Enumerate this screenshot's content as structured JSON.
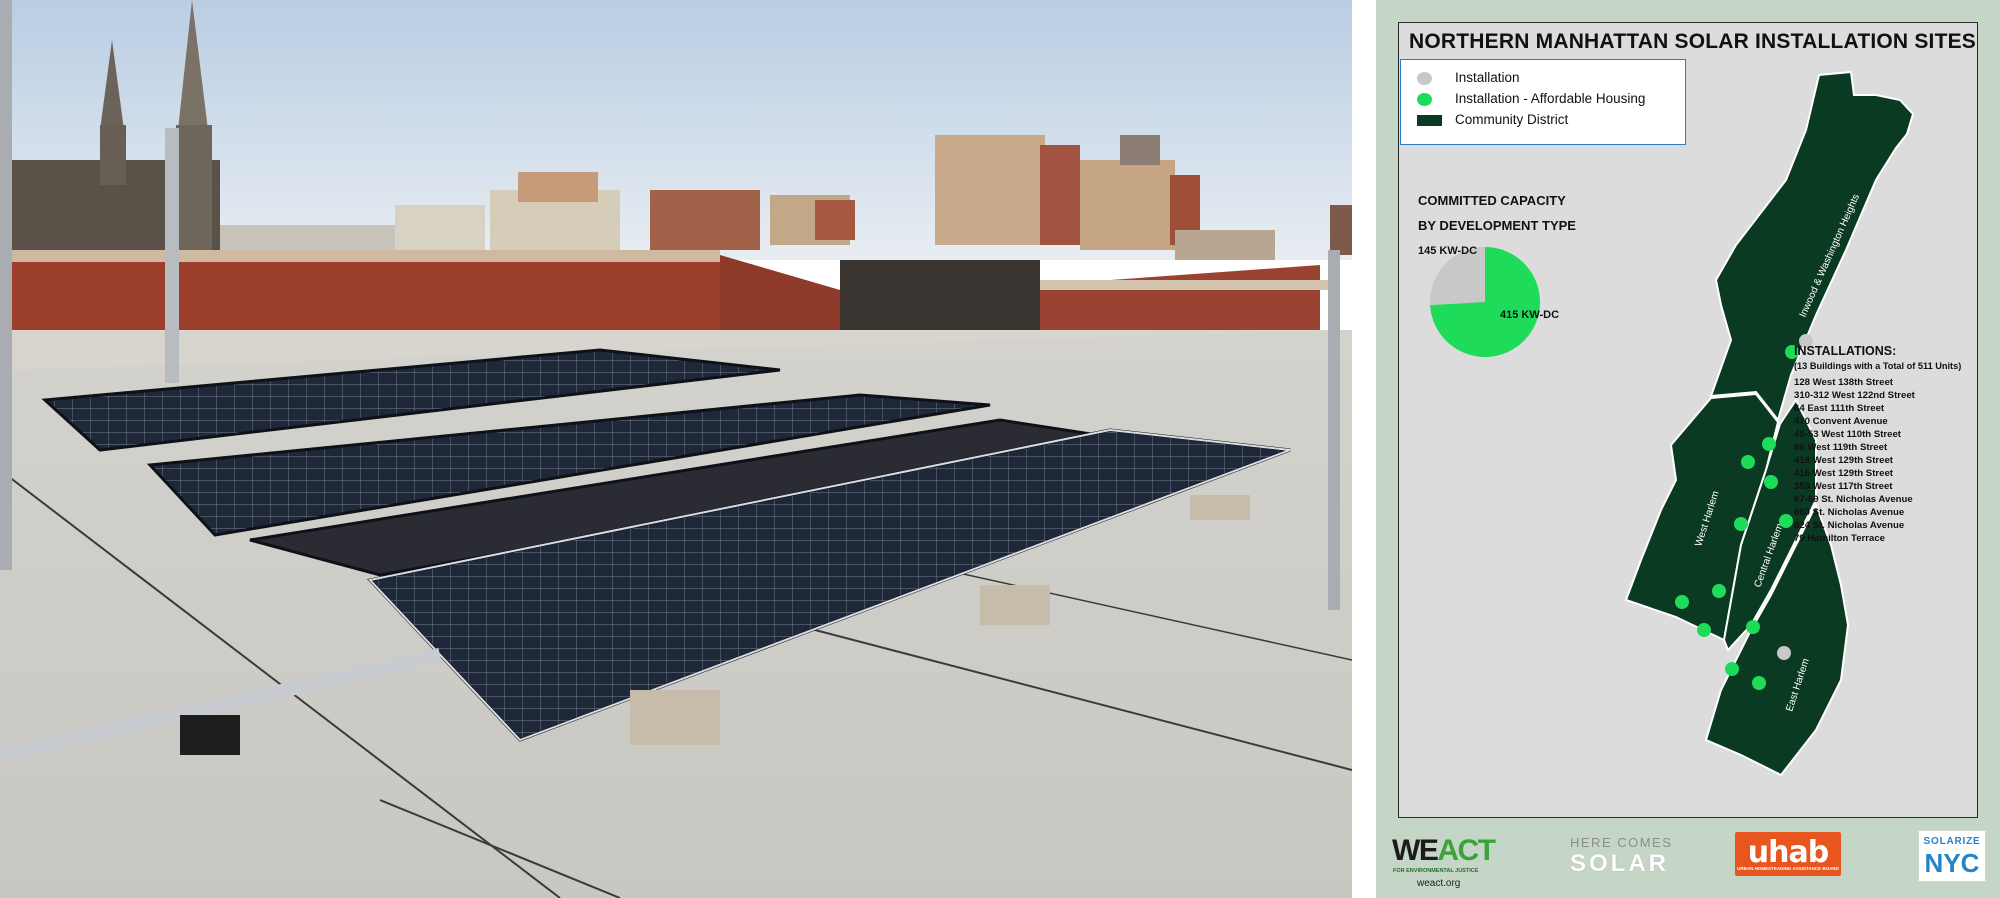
{
  "poster": {
    "title": "NORTHERN MANHATTAN SOLAR INSTALLATION SITES",
    "legend": [
      {
        "label": "Installation",
        "color": "#c8c8c8",
        "shape": "dot"
      },
      {
        "label": "Installation - Affordable Housing",
        "color": "#1edc5a",
        "shape": "dot"
      },
      {
        "label": "Community District",
        "color": "#0b3a23",
        "shape": "rect"
      }
    ],
    "capacity": {
      "title_line1": "COMMITTED CAPACITY",
      "title_line2": "BY DEVELOPMENT TYPE",
      "slices": [
        {
          "label": "145 KW-DC",
          "value": 145,
          "color": "#c8c8c8"
        },
        {
          "label": "415 KW-DC",
          "value": 415,
          "color": "#1edc5a"
        }
      ]
    },
    "districts": [
      {
        "label": "Inwood & Washington Heights"
      },
      {
        "label": "West Harlem"
      },
      {
        "label": "Central Harlem"
      },
      {
        "label": "East Harlem"
      }
    ],
    "installations": {
      "title": "INSTALLATIONS:",
      "subtitle": "(13 Buildings with a Total of 511 Units)",
      "addresses": [
        "128 West 138th Street",
        "310-312 West 122nd Street",
        "64 East 111th Street",
        "470 Convent Avenue",
        "45-53 West 110th Street",
        "86 West 119th Street",
        "418 West 129th Street",
        "416 West 129th Street",
        "353 West 117th Street",
        "67-69 St. Nicholas Avenue",
        "660 St. Nicholas Avenue",
        "824 St. Nicholas Avenue",
        "79 Hamilton Terrace"
      ]
    },
    "logos": {
      "weact": {
        "prefix": "WE",
        "suffix": "ACT",
        "sub": "FOR ENVIRONMENTAL JUSTICE",
        "url": "weact.org"
      },
      "here_comes_solar": {
        "line1": "HERE COMES",
        "line2": "SOLAR"
      },
      "uhab": {
        "name": "uhab",
        "sub": "URBAN HOMESTEADING ASSISTANCE BOARD"
      },
      "solarize": {
        "line1": "SOLARIZE",
        "line2": "NYC"
      }
    }
  },
  "photo": {
    "icon": "rooftop-solar-panels-photo"
  }
}
